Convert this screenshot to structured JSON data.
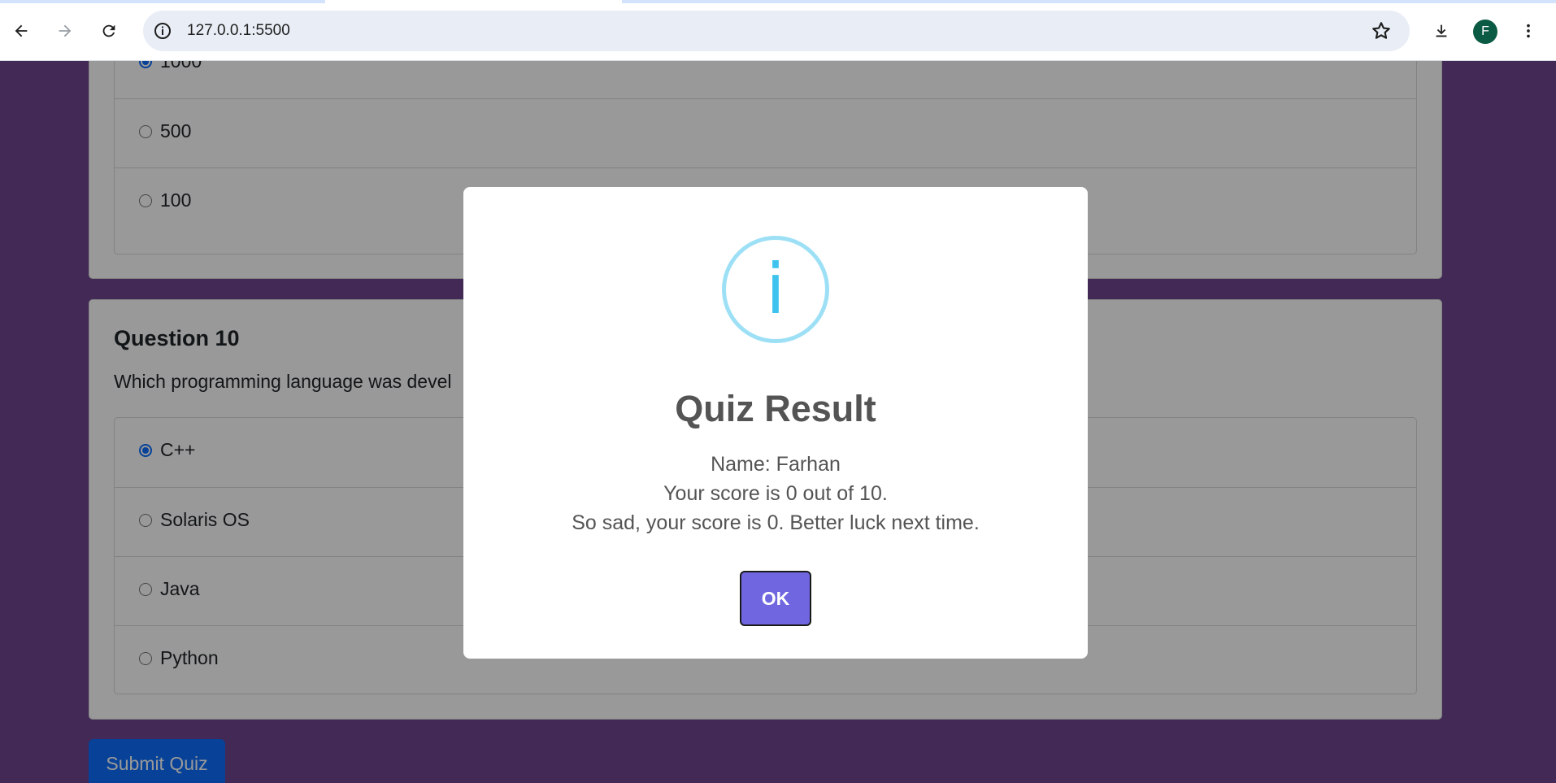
{
  "browser": {
    "url": "127.0.0.1:5500",
    "profile_initial": "F",
    "icons": [
      "back-icon",
      "forward-icon",
      "reload-icon",
      "site-info-icon",
      "bookmark-star-icon",
      "download-icon",
      "more-menu-icon"
    ]
  },
  "quiz": {
    "question9": {
      "options": [
        {
          "label": "1000",
          "checked": true
        },
        {
          "label": "500",
          "checked": false
        },
        {
          "label": "100",
          "checked": false
        }
      ]
    },
    "question10": {
      "title": "Question 10",
      "text": "Which programming language was devel",
      "options": [
        {
          "label": "C++",
          "checked": true
        },
        {
          "label": "Solaris OS",
          "checked": false
        },
        {
          "label": "Java",
          "checked": false
        },
        {
          "label": "Python",
          "checked": false
        }
      ]
    },
    "submit_label": "Submit Quiz"
  },
  "modal": {
    "icon": "info-icon",
    "icon_glyph": "i",
    "title": "Quiz Result",
    "name_line": "Name: Farhan",
    "score_line": "Your score is 0 out of 10.",
    "message_line": "So sad, your score is 0. Better luck next time.",
    "ok_label": "OK"
  },
  "colors": {
    "page_background": "#6f4590",
    "primary": "#0d6efd",
    "confirm_button": "#7066e0",
    "info_icon": "#3fc3ee"
  }
}
